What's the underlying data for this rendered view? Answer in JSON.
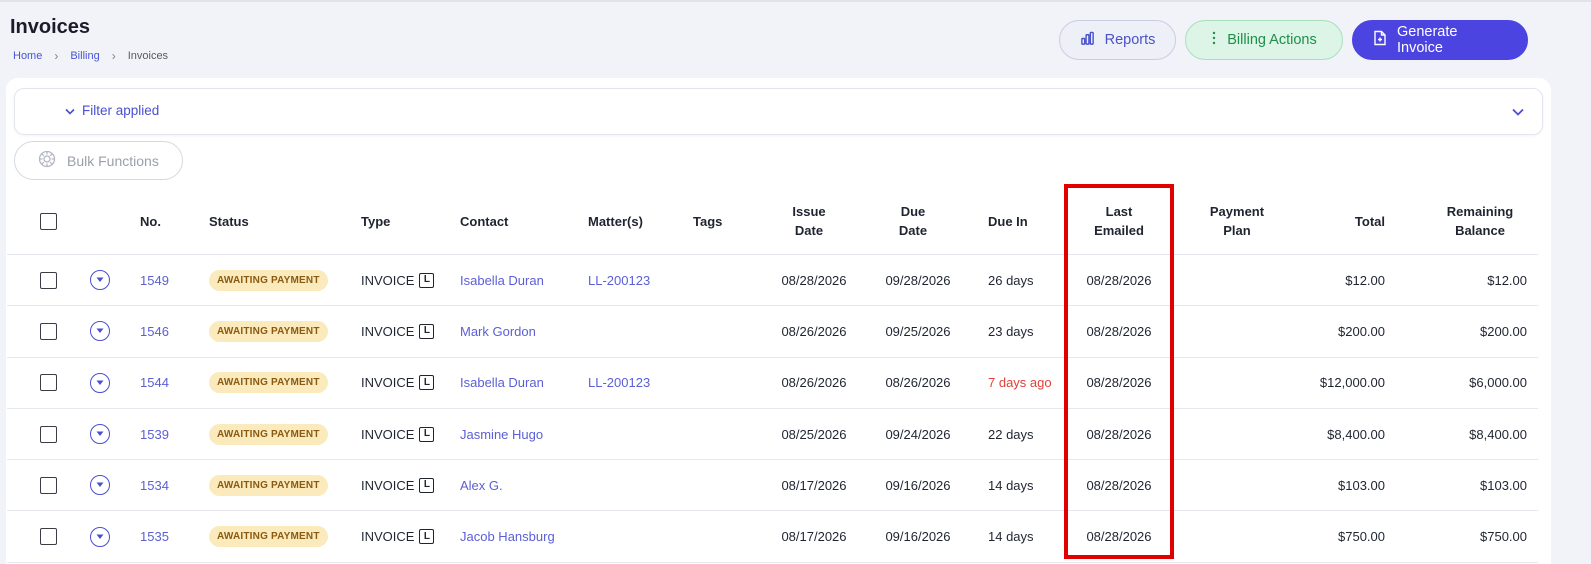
{
  "header": {
    "title": "Invoices",
    "breadcrumb": [
      "Home",
      "Billing",
      "Invoices"
    ],
    "buttons": {
      "reports": "Reports",
      "billing_actions": "Billing Actions",
      "generate_invoice": "Generate Invoice"
    }
  },
  "filter": {
    "label": "Filter applied"
  },
  "bulk": {
    "label": "Bulk Functions"
  },
  "table": {
    "headers": {
      "no": "No.",
      "status": "Status",
      "type": "Type",
      "contact": "Contact",
      "matters": "Matter(s)",
      "tags": "Tags",
      "issue_date": [
        "Issue",
        "Date"
      ],
      "due_date": [
        "Due",
        "Date"
      ],
      "due_in": "Due In",
      "last_emailed": [
        "Last",
        "Emailed"
      ],
      "payment_plan": [
        "Payment",
        "Plan"
      ],
      "total": "Total",
      "remaining_balance": [
        "Remaining",
        "Balance"
      ]
    },
    "rows": [
      {
        "no": "1549",
        "status": "AWAITING PAYMENT",
        "type": "INVOICE",
        "type_badge": "L",
        "contact": "Isabella Duran",
        "matter": "LL-200123",
        "tags": "",
        "issue_date": "08/28/2026",
        "due_date": "09/28/2026",
        "due_in": "26 days",
        "overdue": false,
        "last_emailed": "08/28/2026",
        "payment_plan": "",
        "total": "$12.00",
        "remaining": "$12.00"
      },
      {
        "no": "1546",
        "status": "AWAITING PAYMENT",
        "type": "INVOICE",
        "type_badge": "L",
        "contact": "Mark Gordon",
        "matter": "",
        "tags": "",
        "issue_date": "08/26/2026",
        "due_date": "09/25/2026",
        "due_in": "23 days",
        "overdue": false,
        "last_emailed": "08/28/2026",
        "payment_plan": "",
        "total": "$200.00",
        "remaining": "$200.00"
      },
      {
        "no": "1544",
        "status": "AWAITING PAYMENT",
        "type": "INVOICE",
        "type_badge": "L",
        "contact": "Isabella Duran",
        "matter": "LL-200123",
        "tags": "",
        "issue_date": "08/26/2026",
        "due_date": "08/26/2026",
        "due_in": "7 days ago",
        "overdue": true,
        "last_emailed": "08/28/2026",
        "payment_plan": "",
        "total": "$12,000.00",
        "remaining": "$6,000.00"
      },
      {
        "no": "1539",
        "status": "AWAITING PAYMENT",
        "type": "INVOICE",
        "type_badge": "L",
        "contact": "Jasmine Hugo",
        "matter": "",
        "tags": "",
        "issue_date": "08/25/2026",
        "due_date": "09/24/2026",
        "due_in": "22 days",
        "overdue": false,
        "last_emailed": "08/28/2026",
        "payment_plan": "",
        "total": "$8,400.00",
        "remaining": "$8,400.00"
      },
      {
        "no": "1534",
        "status": "AWAITING PAYMENT",
        "type": "INVOICE",
        "type_badge": "L",
        "contact": "Alex G.",
        "matter": "",
        "tags": "",
        "issue_date": "08/17/2026",
        "due_date": "09/16/2026",
        "due_in": "14 days",
        "overdue": false,
        "last_emailed": "08/28/2026",
        "payment_plan": "",
        "total": "$103.00",
        "remaining": "$103.00"
      },
      {
        "no": "1535",
        "status": "AWAITING PAYMENT",
        "type": "INVOICE",
        "type_badge": "L",
        "contact": "Jacob Hansburg",
        "matter": "",
        "tags": "",
        "issue_date": "08/17/2026",
        "due_date": "09/16/2026",
        "due_in": "14 days",
        "overdue": false,
        "last_emailed": "08/28/2026",
        "payment_plan": "",
        "total": "$750.00",
        "remaining": "$750.00"
      }
    ]
  },
  "colors": {
    "accent": "#4b44e0",
    "link": "#5b5fd6",
    "overdue": "#e0413a",
    "badge_bg": "#fbeabb",
    "highlight": "#e00000"
  },
  "icons": {
    "reports": "bar-chart-icon",
    "billing_actions": "vertical-ellipsis-icon",
    "generate_invoice": "document-plus-icon",
    "filter": "chevron-down-icon",
    "bulk": "gear-icon",
    "row_expand": "circle-chevron-down-icon"
  }
}
